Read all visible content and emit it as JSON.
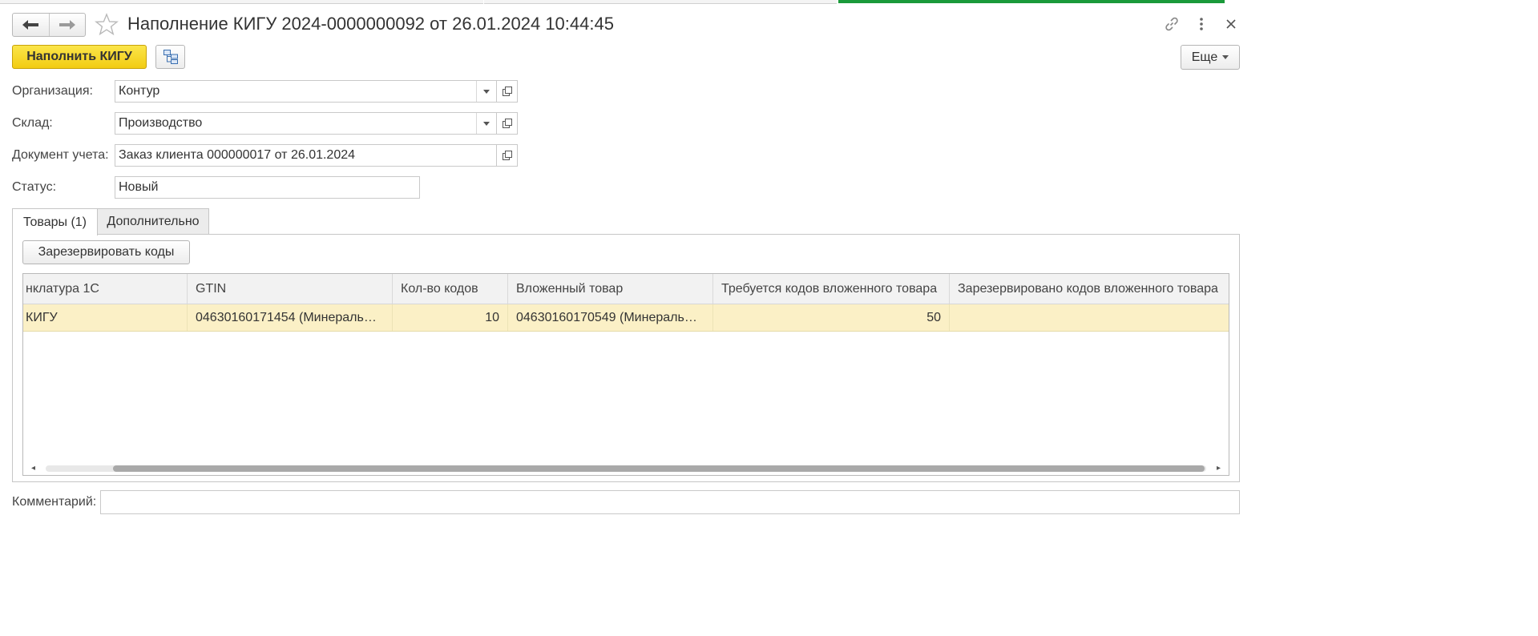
{
  "window": {
    "title": "Наполнение КИГУ 2024-0000000092 от 26.01.2024 10:44:45"
  },
  "toolbar": {
    "fill_label": "Наполнить КИГУ",
    "more_label": "Еще"
  },
  "form": {
    "organization": {
      "label": "Организация:",
      "value": "Контур"
    },
    "warehouse": {
      "label": "Склад:",
      "value": "Производство"
    },
    "document": {
      "label": "Документ учета:",
      "value": "Заказ клиента 000000017 от 26.01.2024"
    },
    "status": {
      "label": "Статус:",
      "value": "Новый"
    },
    "comment": {
      "label": "Комментарий:",
      "value": ""
    }
  },
  "tabs": [
    {
      "label": "Товары (1)",
      "active": true
    },
    {
      "label": "Дополнительно",
      "active": false
    }
  ],
  "goods": {
    "reserve_label": "Зарезервировать коды",
    "columns": [
      "нклатура 1С",
      "GTIN",
      "Кол-во кодов",
      "Вложенный товар",
      "Требуется кодов вложенного товара",
      "Зарезервировано кодов вложенного товара"
    ],
    "rows": [
      {
        "nomenclature": "КИГУ",
        "gtin": "04630160171454 (Минераль…",
        "codes_count": "10",
        "nested_product": "04630160170549 (Минераль…",
        "nested_required": "50",
        "nested_reserved": ""
      }
    ]
  },
  "icons": {
    "back": "arrow-left-icon",
    "forward": "arrow-right-icon",
    "favorite": "star-icon",
    "link": "link-icon",
    "menu": "kebab-menu-icon",
    "close": "close-icon",
    "structure": "document-structure-icon",
    "dropdown": "chevron-down-icon",
    "open": "open-form-icon"
  },
  "colors": {
    "primary_button": "#f5d21c",
    "selected_row": "#fbf0c6",
    "active_indicator": "#1a9a3a"
  }
}
